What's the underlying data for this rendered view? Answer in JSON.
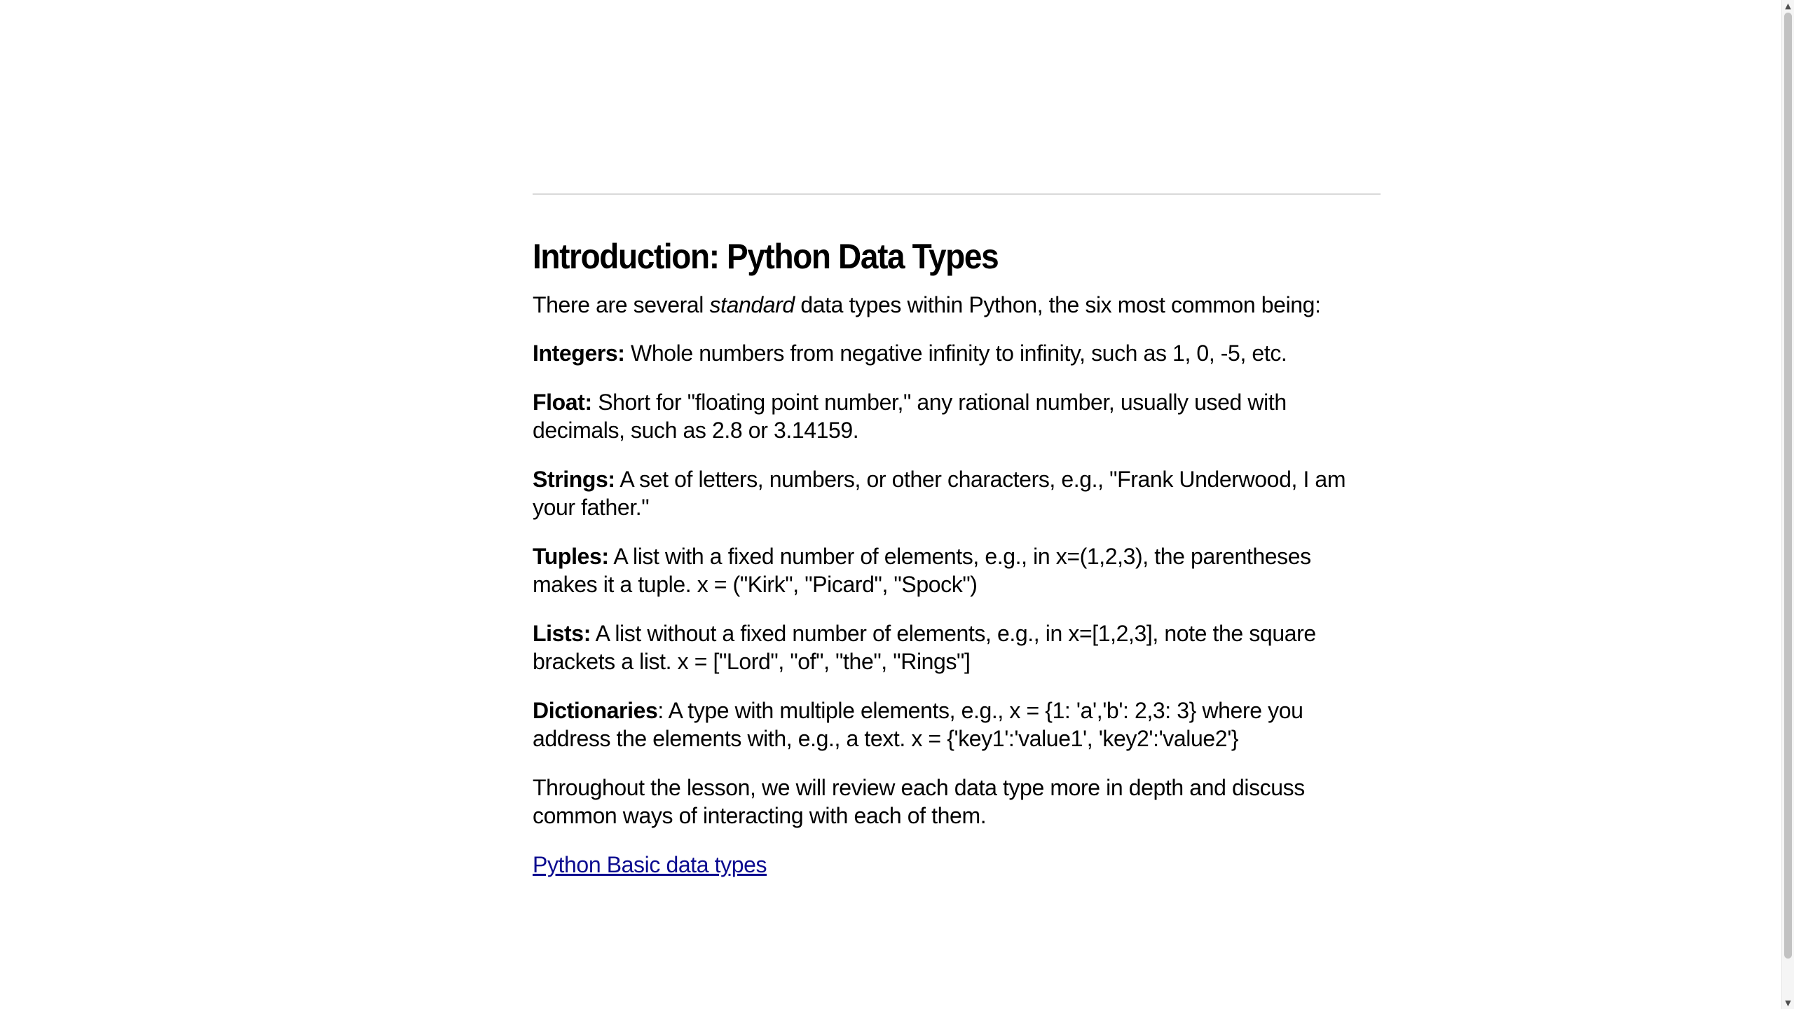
{
  "article": {
    "title": "Introduction: Python Data Types",
    "intro": {
      "before": "There are several ",
      "emphasis": "standard",
      "after": " data types within Python, the six most common being:"
    },
    "types": [
      {
        "term": "Integers:",
        "desc": " Whole numbers from negative infinity to infinity, such as 1, 0, -5, etc."
      },
      {
        "term": "Float:",
        "desc": " Short for \"floating point number,\" any rational number, usually used with decimals, such as 2.8 or 3.14159."
      },
      {
        "term": "Strings:",
        "desc": " A set of letters, numbers, or other characters, e.g., \"Frank Underwood, I am your father.\""
      },
      {
        "term": "Tuples:",
        "desc": " A list with a fixed number of elements, e.g., in x=(1,2,3), the parentheses makes it a tuple. x = (\"Kirk\", \"Picard\", \"Spock\")"
      },
      {
        "term": "Lists:",
        "desc": " A list without a fixed number of elements, e.g., in x=[1,2,3], note the square brackets a list. x = [\"Lord\", \"of\", \"the\", \"Rings\"]"
      },
      {
        "term": "Dictionaries",
        "desc": ": A type with multiple elements, e.g., x = {1: 'a','b': 2,3: 3} where you address the elements with, e.g., a text. x = {'key1':'value1', 'key2':'value2'}"
      }
    ],
    "closing": "Throughout the lesson, we will review each data type more in depth and discuss common ways of interacting with each of them.",
    "link_text": "Python Basic data types"
  },
  "scrollbar": {
    "up_icon": "triangle-up",
    "down_icon": "triangle-down",
    "position": 0.0
  },
  "colors": {
    "link": "#0b0b8f",
    "text": "#000000",
    "rule": "#d9d9d9"
  }
}
